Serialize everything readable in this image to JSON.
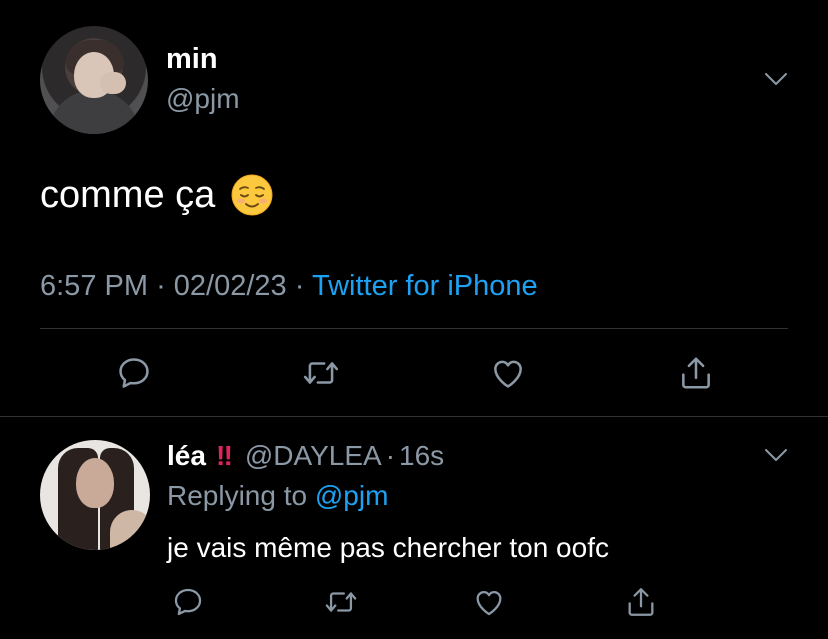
{
  "tweet": {
    "author": {
      "name": "min",
      "handle": "@pjm"
    },
    "text": "comme ça",
    "emoji": "relieved-face",
    "meta": {
      "time": "6:57 PM",
      "separator": "·",
      "date": "02/02/23",
      "source": "Twitter for iPhone"
    },
    "actions": [
      {
        "name": "reply",
        "icon": "reply-icon"
      },
      {
        "name": "retweet",
        "icon": "retweet-icon"
      },
      {
        "name": "like",
        "icon": "heart-icon"
      },
      {
        "name": "share",
        "icon": "share-icon"
      }
    ]
  },
  "reply": {
    "author": {
      "name": "léa",
      "badge": "‼",
      "handle": "@DAYLEA",
      "separator": "·",
      "time": "16s"
    },
    "replying_prefix": "Replying to",
    "replying_to": "@pjm",
    "text": "je vais même pas chercher ton oofc"
  },
  "colors": {
    "background": "#000000",
    "primary_text": "#ffffff",
    "secondary_text": "#8b98a5",
    "accent": "#1da1f2",
    "divider": "#2f3336",
    "badge": "#e0245e"
  }
}
